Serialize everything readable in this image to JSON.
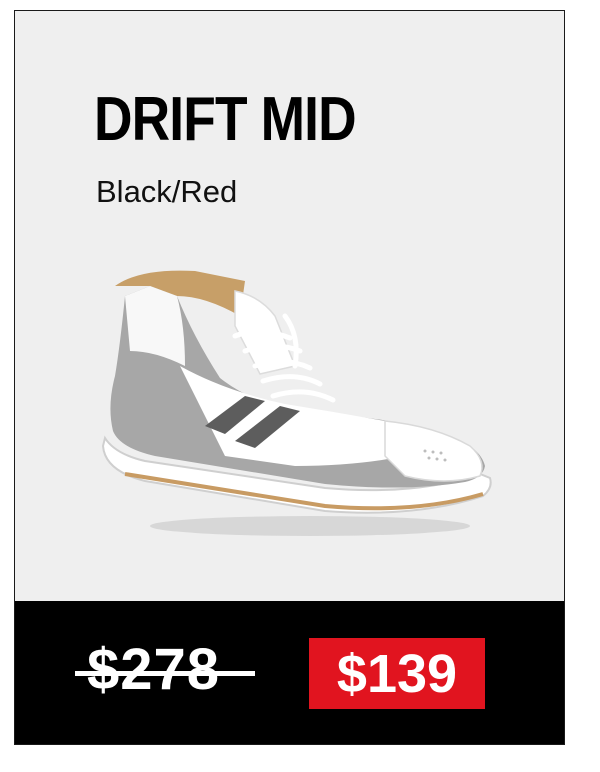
{
  "product": {
    "name": "DRIFT MID",
    "colorway": "Black/Red"
  },
  "pricing": {
    "original_price": "$278",
    "sale_price": "$139"
  },
  "colors": {
    "card_background": "#efefef",
    "price_bar": "#000000",
    "sale_badge": "#e1141f",
    "text": "#000000"
  },
  "image": {
    "icon": "sneaker-image"
  }
}
